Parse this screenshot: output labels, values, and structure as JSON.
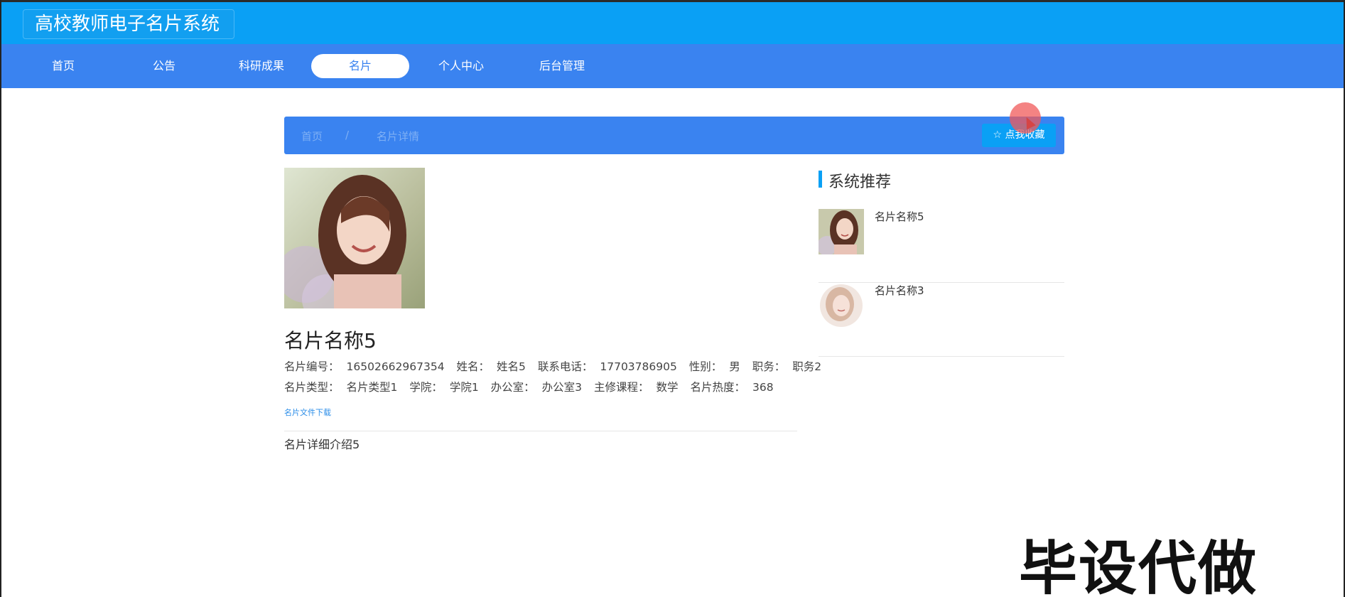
{
  "header": {
    "title": "高校教师电子名片系统"
  },
  "nav": {
    "items": [
      {
        "label": "首页"
      },
      {
        "label": "公告"
      },
      {
        "label": "科研成果"
      },
      {
        "label": "名片"
      },
      {
        "label": "个人中心"
      },
      {
        "label": "后台管理"
      }
    ],
    "active_index": 3
  },
  "breadcrumb": {
    "home": "首页",
    "separator": "/",
    "current": "名片详情",
    "favorite_button": "☆ 点我收藏"
  },
  "card": {
    "title": "名片名称5",
    "fields_line1": [
      {
        "key": "名片编号：",
        "value": "16502662967354"
      },
      {
        "key": "姓名：",
        "value": "姓名5"
      },
      {
        "key": "联系电话：",
        "value": "17703786905"
      },
      {
        "key": "性别：",
        "value": "男"
      },
      {
        "key": "职务：",
        "value": "职务2"
      }
    ],
    "fields_line2": [
      {
        "key": "名片类型：",
        "value": "名片类型1"
      },
      {
        "key": "学院：",
        "value": "学院1"
      },
      {
        "key": "办公室：",
        "value": "办公室3"
      },
      {
        "key": "主修课程：",
        "value": "数学"
      },
      {
        "key": "名片热度：",
        "value": "368"
      }
    ],
    "download_link": "名片文件下载",
    "detail": "名片详细介绍5"
  },
  "sidebar": {
    "title": "系统推荐",
    "items": [
      {
        "name": "名片名称5"
      },
      {
        "name": "名片名称3"
      }
    ]
  },
  "watermark": "毕设代做",
  "colors": {
    "topbar": "#0aa0f5",
    "navbar": "#3a83f0",
    "accent": "#0aa0f5"
  }
}
